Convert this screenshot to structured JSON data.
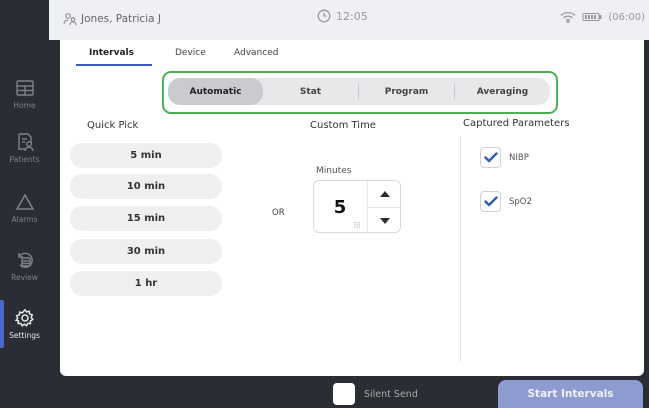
{
  "topbar": {
    "patient_name": "Jones, Patricia J",
    "time": "12:05",
    "battery_text": "(06:00)"
  },
  "sidebar": {
    "items": [
      {
        "label": "Home",
        "icon": "home-icon"
      },
      {
        "label": "Patients",
        "icon": "patients-icon"
      },
      {
        "label": "Alarms",
        "icon": "alarm-triangle-icon"
      },
      {
        "label": "Review",
        "icon": "review-icon"
      },
      {
        "label": "Settings",
        "icon": "gear-icon",
        "active": true
      }
    ]
  },
  "tabs": [
    {
      "label": "Intervals",
      "active": true
    },
    {
      "label": "Device"
    },
    {
      "label": "Advanced"
    }
  ],
  "mode_segments": [
    {
      "label": "Automatic",
      "active": true
    },
    {
      "label": "Stat"
    },
    {
      "label": "Program"
    },
    {
      "label": "Averaging"
    }
  ],
  "quick_pick": {
    "title": "Quick Pick",
    "options": [
      "5 min",
      "10 min",
      "15 min",
      "30 min",
      "1 hr"
    ]
  },
  "custom_time": {
    "title": "Custom Time",
    "or_label": "OR",
    "minutes_label": "Minutes",
    "value": "5"
  },
  "captured_parameters": {
    "title": "Captured Parameters",
    "items": [
      {
        "label": "NIBP",
        "checked": true
      },
      {
        "label": "SpO2",
        "checked": true
      }
    ]
  },
  "footer": {
    "silent_send_label": "Silent Send",
    "silent_send_checked": false,
    "start_button_label": "Start Intervals"
  },
  "colors": {
    "accent": "#3b5bbf",
    "highlight_outline": "#4caf50",
    "start_button": "#8d9bd0",
    "checkbox_check": "#2f5bbd"
  }
}
